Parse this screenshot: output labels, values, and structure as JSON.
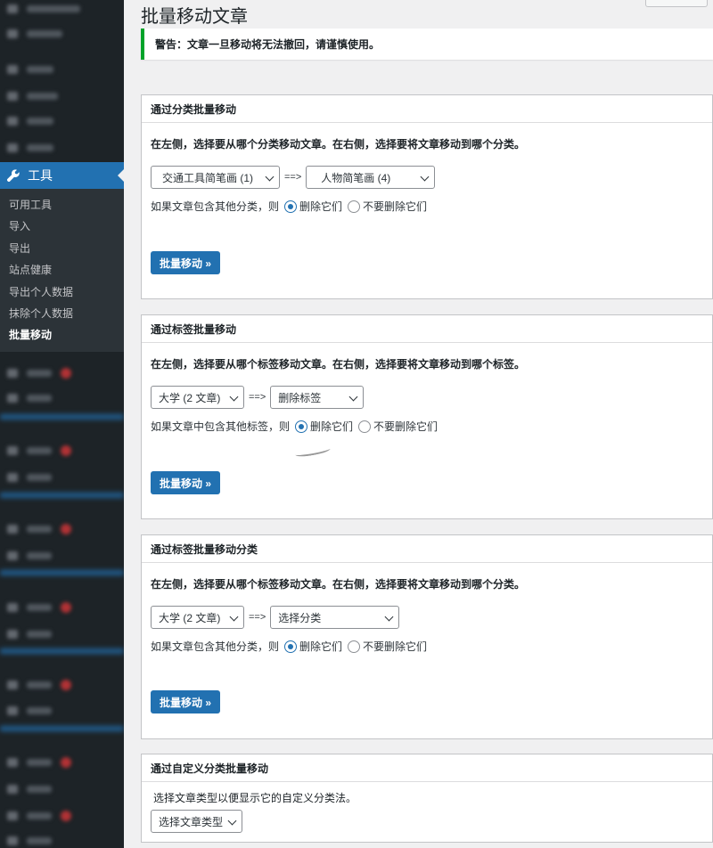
{
  "sidebar": {
    "tools_label": "工具",
    "submenu": [
      {
        "label": "可用工具",
        "active": false
      },
      {
        "label": "导入",
        "active": false
      },
      {
        "label": "导出",
        "active": false
      },
      {
        "label": "站点健康",
        "active": false
      },
      {
        "label": "导出个人数据",
        "active": false
      },
      {
        "label": "抹除个人数据",
        "active": false
      },
      {
        "label": "批量移动",
        "active": true
      }
    ]
  },
  "page": {
    "title": "批量移动文章",
    "notice": "警告：文章一旦移动将无法撤回，请谨慎使用。"
  },
  "category_move": {
    "header": "通过分类批量移动",
    "description": "在左侧，选择要从哪个分类移动文章。在右侧，选择要将文章移动到哪个分类。",
    "from_value": "交通工具简笔画  (1)",
    "separator": "==>",
    "to_value": "人物简笔画  (4)",
    "option_prefix": "如果文章包含其他分类，则",
    "option_delete": "删除它们",
    "option_keep": "不要删除它们",
    "button": "批量移动 »"
  },
  "tag_move": {
    "header": "通过标签批量移动",
    "description": "在左侧，选择要从哪个标签移动文章。在右侧，选择要将文章移动到哪个标签。",
    "from_value": "大学 (2 文章)",
    "separator": "==>",
    "to_value": "删除标签",
    "option_prefix": "如果文章中包含其他标签，则",
    "option_delete": "删除它们",
    "option_keep": "不要删除它们",
    "button": "批量移动 »"
  },
  "tag_to_category": {
    "header": "通过标签批量移动分类",
    "description": "在左侧，选择要从哪个标签移动文章。在右侧，选择要将文章移动到哪个分类。",
    "from_value": "大学 (2 文章)",
    "separator": "==>",
    "to_value": "选择分类",
    "option_prefix": "如果文章包含其他分类，则",
    "option_delete": "删除它们",
    "option_keep": "不要删除它们",
    "button": "批量移动 »"
  },
  "custom_taxonomy": {
    "header": "通过自定义分类批量移动",
    "description": "选择文章类型以便显示它的自定义分类法。",
    "select_value": "选择文章类型"
  },
  "icons": {
    "tools": "wrench-icon",
    "dropdown": "chevron-down-icon"
  },
  "colors": {
    "accent": "#2271b1",
    "sidebar_bg": "#1d2327",
    "notice_border": "#00a32a"
  }
}
